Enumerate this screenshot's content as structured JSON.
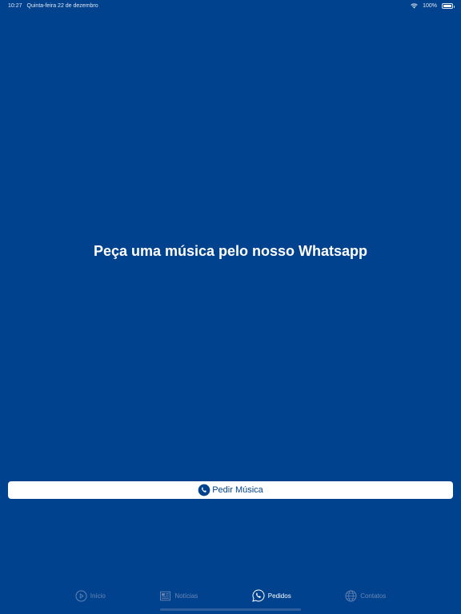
{
  "status_bar": {
    "time": "10:27",
    "date": "Quinta-feira 22 de dezembro",
    "battery": "100%"
  },
  "main": {
    "headline": "Peça uma música pelo nosso Whatsapp",
    "button_label": "Pedir Música"
  },
  "tab_bar": {
    "items": [
      {
        "label": "Início",
        "icon": "play-circle-icon",
        "active": false
      },
      {
        "label": "Notícias",
        "icon": "newspaper-icon",
        "active": false
      },
      {
        "label": "Pedidos",
        "icon": "whatsapp-icon",
        "active": true
      },
      {
        "label": "Contatos",
        "icon": "globe-icon",
        "active": false
      }
    ]
  },
  "colors": {
    "background": "#01428e",
    "button_bg": "#ffffff",
    "button_text": "#01428e",
    "tab_inactive": "#6c87b4",
    "tab_active": "#ffffff"
  }
}
